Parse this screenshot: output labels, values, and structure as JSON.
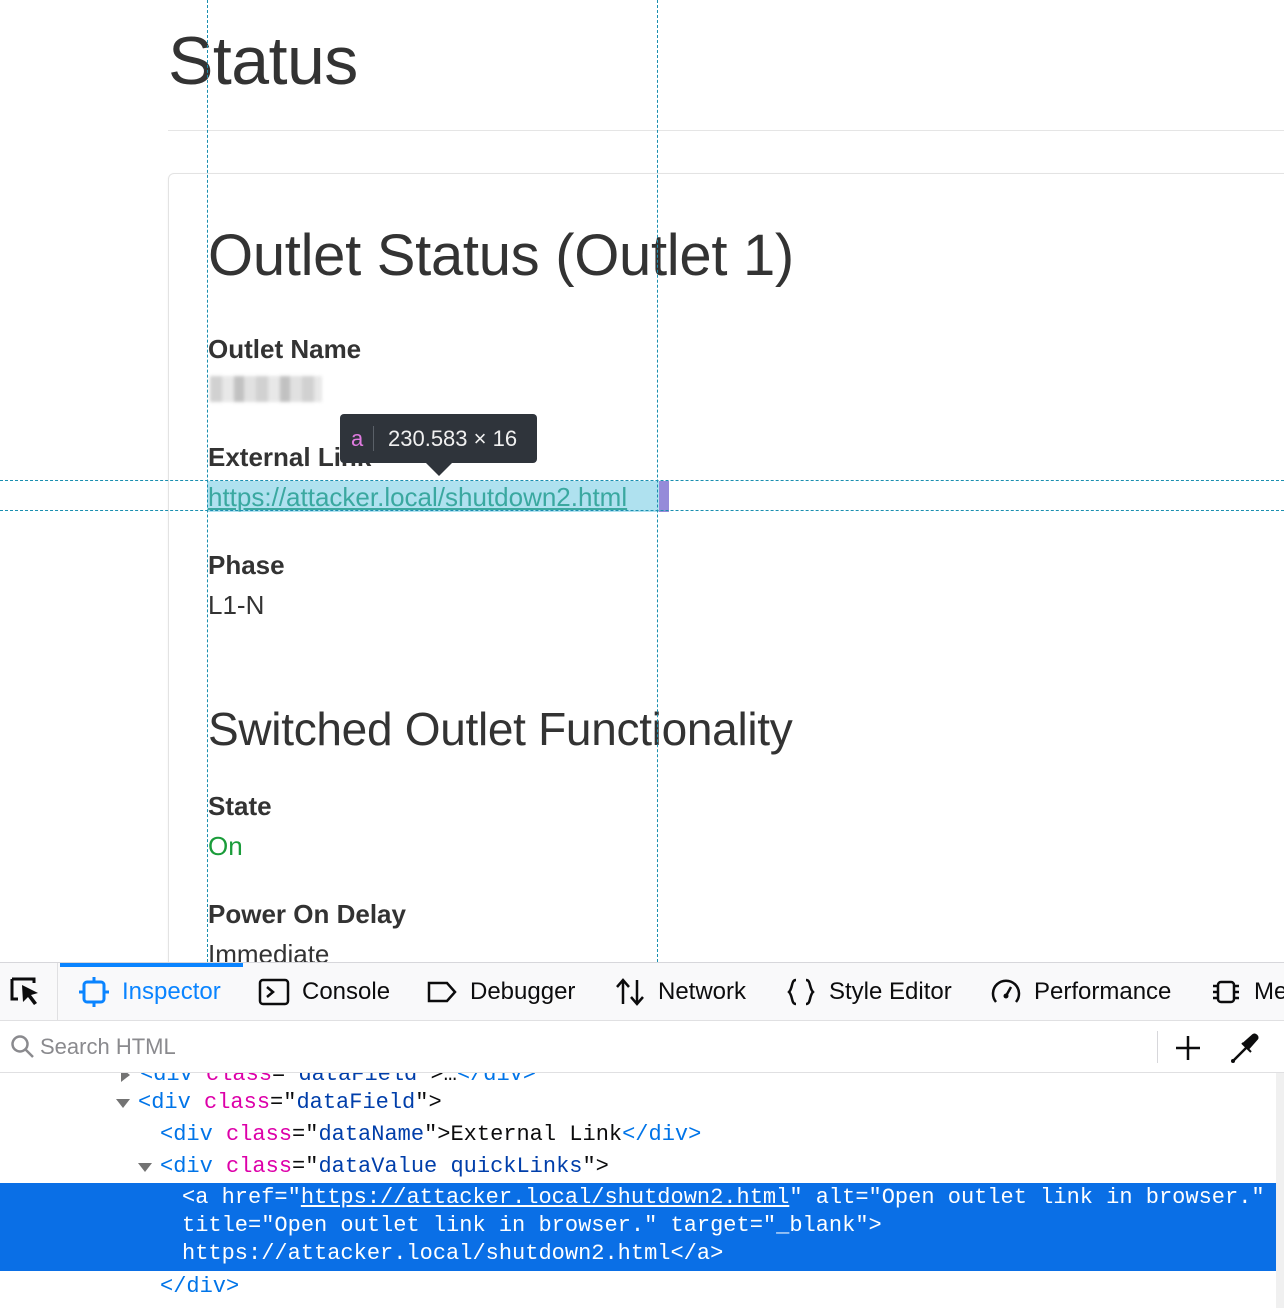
{
  "page": {
    "title": "Status",
    "section1_title": "Outlet Status  (Outlet 1)",
    "outlet_name_label": "Outlet Name",
    "external_link_label": "External Link",
    "external_link_value": "https://attacker.local/shutdown2.html",
    "phase_label": "Phase",
    "phase_value": "L1-N",
    "section2_title": "Switched Outlet Functionality",
    "state_label": "State",
    "state_value": "On",
    "state_color": "#1a9c3a",
    "power_on_delay_label": "Power On Delay",
    "power_on_delay_value": "Immediate"
  },
  "highlight_tooltip": {
    "tag": "a",
    "dimensions": "230.583 × 16"
  },
  "devtools": {
    "tabs": [
      {
        "label": "Inspector",
        "icon": "inspector-icon",
        "active": true
      },
      {
        "label": "Console",
        "icon": "console-icon"
      },
      {
        "label": "Debugger",
        "icon": "debugger-icon"
      },
      {
        "label": "Network",
        "icon": "network-icon"
      },
      {
        "label": "Style Editor",
        "icon": "style-editor-icon"
      },
      {
        "label": "Performance",
        "icon": "performance-icon"
      },
      {
        "label": "Me",
        "icon": "memory-icon"
      }
    ],
    "search_placeholder": "Search HTML",
    "accent_color": "#0a84ff",
    "tree": {
      "line0": {
        "open": "<",
        "tag": "div",
        "attr": "class",
        "eq": "=\"",
        "val": "dataField",
        "rest": "\">",
        "mid": "…",
        "close": "</",
        "ctag": "div",
        "end": ">"
      },
      "line1": {
        "open": "<",
        "tag": "div",
        "attr": " class",
        "eq": "=\"",
        "val": "dataField",
        "end": "\">"
      },
      "line2": {
        "open": "<",
        "tag": "div",
        "attr": " class",
        "eq": "=\"",
        "val": "dataName",
        "mid": "\">",
        "text": "External Link",
        "close": "</",
        "ctag": "div",
        "end": ">"
      },
      "line3": {
        "open": "<",
        "tag": "div",
        "attr": " class",
        "eq": "=\"",
        "val": "dataValue quickLinks",
        "end": "\">"
      },
      "sel1": {
        "open": "<",
        "tag": "a",
        "a1": " href",
        "eq1": "=\"",
        "v1": "https://attacker.local/shutdown2.html",
        "q1": "\"",
        "a2": " alt",
        "eq2": "=\"",
        "v2": "Open outlet link in browser.",
        "q2": "\""
      },
      "sel2": {
        "a3": "title",
        "eq3": "=\"",
        "v3": "Open outlet link in browser.",
        "q3": "\"",
        "a4": " target",
        "eq4": "=\"",
        "v4": "_blank",
        "end": "\">"
      },
      "sel3": {
        "text": "https://attacker.local/shutdown2.html",
        "close": "</",
        "ctag": "a",
        "end": ">"
      },
      "line4": {
        "close": "</",
        "ctag": "div",
        "end": ">"
      }
    }
  }
}
